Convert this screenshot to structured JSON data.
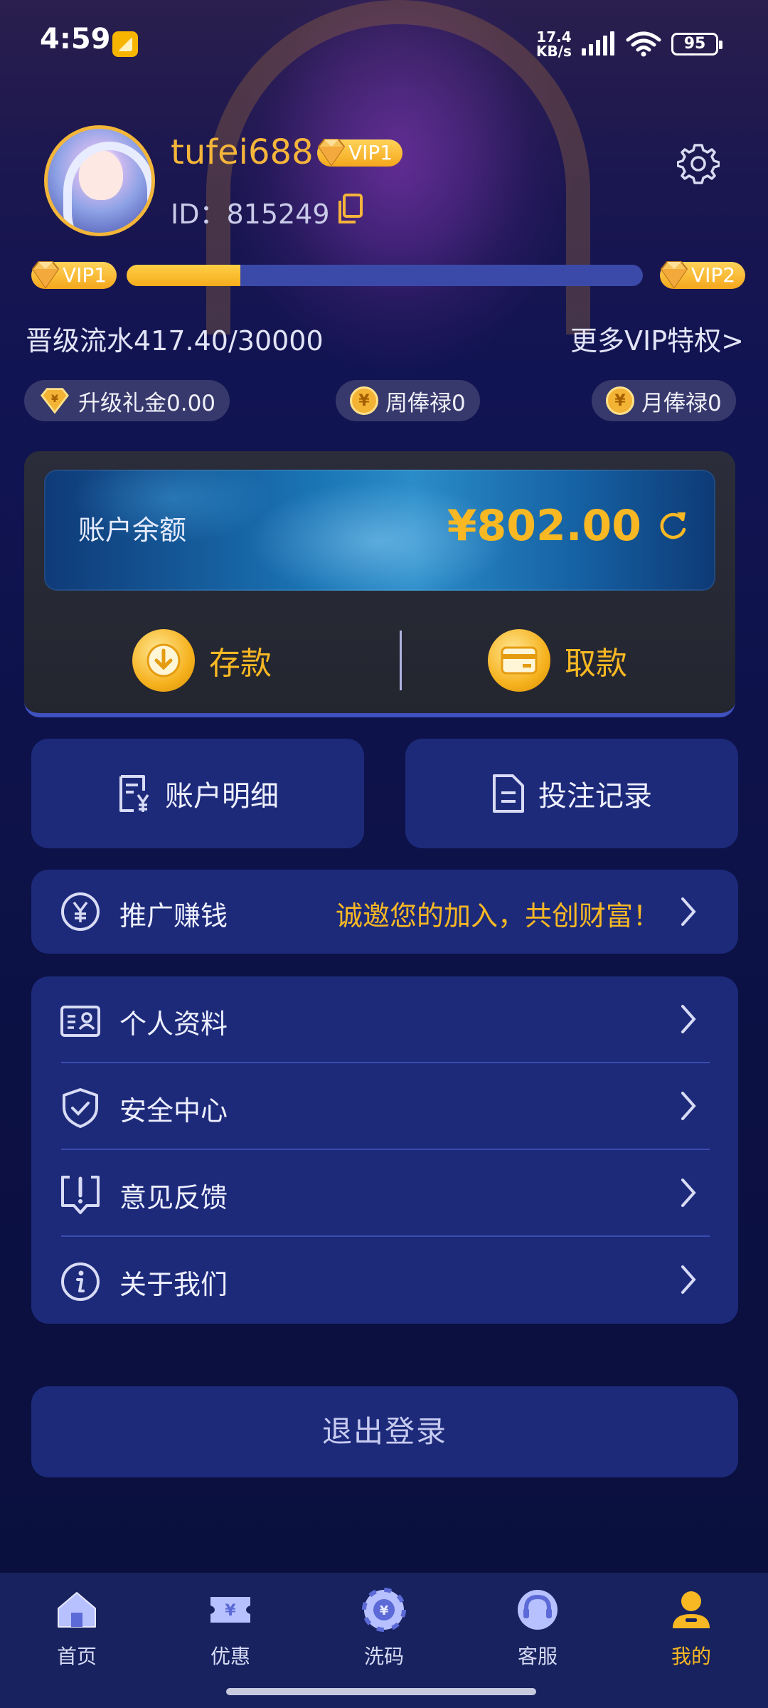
{
  "status_bar": {
    "time": "4:59",
    "net_speed_value": "17.4",
    "net_speed_unit": "KB/s",
    "battery": "95"
  },
  "profile": {
    "username": "tufei688",
    "vip_level": "VIP1",
    "id_label": "ID：",
    "id_value": "815249"
  },
  "vip_progress": {
    "current_level": "VIP1",
    "next_level": "VIP2",
    "current": 417.4,
    "target": 30000,
    "fill_fraction": 0.22,
    "upgrade_text": "晋级流水417.40/30000",
    "more_link": "更多VIP特权>"
  },
  "rewards": [
    {
      "label": "升级礼金0.00",
      "icon": "diamond-coin-icon"
    },
    {
      "label": "周俸禄0",
      "icon": "yen-coin-icon"
    },
    {
      "label": "月俸禄0",
      "icon": "yen-coin-icon"
    }
  ],
  "wallet": {
    "balance_label": "账户余额",
    "balance_value": "¥802.00",
    "deposit_label": "存款",
    "withdraw_label": "取款"
  },
  "tiles": {
    "account_details": "账户明细",
    "bet_records": "投注记录"
  },
  "promo": {
    "label": "推广赚钱",
    "tagline": "诚邀您的加入，共创财富！"
  },
  "menu": [
    {
      "label": "个人资料",
      "icon": "id-card-icon"
    },
    {
      "label": "安全中心",
      "icon": "shield-icon"
    },
    {
      "label": "意见反馈",
      "icon": "feedback-icon"
    },
    {
      "label": "关于我们",
      "icon": "info-icon"
    }
  ],
  "logout_label": "退出登录",
  "bottom_nav": [
    {
      "label": "首页",
      "icon": "home-icon",
      "active": false
    },
    {
      "label": "优惠",
      "icon": "ticket-icon",
      "active": false
    },
    {
      "label": "洗码",
      "icon": "chip-icon",
      "active": false
    },
    {
      "label": "客服",
      "icon": "headset-icon",
      "active": false
    },
    {
      "label": "我的",
      "icon": "user-icon",
      "active": true
    }
  ],
  "colors": {
    "accent_gold": "#f8b824",
    "card_blue": "#1d2a7a",
    "progress_track": "#3b4aa8"
  }
}
